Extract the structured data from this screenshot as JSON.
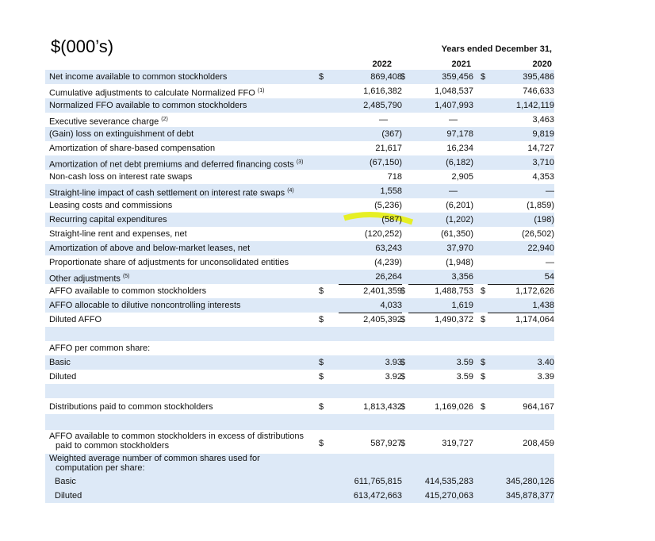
{
  "units_label": "$(000’s)",
  "header": {
    "period_title": "Years ended December 31,",
    "years": [
      "2022",
      "2021",
      "2020"
    ]
  },
  "rows": [
    {
      "label": "Net income available to common stockholders",
      "sup": "",
      "v": [
        "869,408",
        "359,456",
        "395,486"
      ]
    },
    {
      "label": "Cumulative adjustments to calculate Normalized FFO",
      "sup": "(1)",
      "v": [
        "1,616,382",
        "1,048,537",
        "746,633"
      ]
    },
    {
      "label": "Normalized FFO available to common stockholders",
      "sup": "",
      "v": [
        "2,485,790",
        "1,407,993",
        "1,142,119"
      ]
    },
    {
      "label": "Executive severance charge",
      "sup": "(2)",
      "v": [
        "—",
        "—",
        "3,463"
      ]
    },
    {
      "label": "(Gain) loss on extinguishment of debt",
      "sup": "",
      "v": [
        "(367)",
        "97,178",
        "9,819"
      ]
    },
    {
      "label": "Amortization of share-based compensation",
      "sup": "",
      "v": [
        "21,617",
        "16,234",
        "14,727"
      ]
    },
    {
      "label": "Amortization of net debt premiums and deferred financing costs",
      "sup": "(3)",
      "v": [
        "(67,150)",
        "(6,182)",
        "3,710"
      ]
    },
    {
      "label": "Non-cash loss on interest rate swaps",
      "sup": "",
      "v": [
        "718",
        "2,905",
        "4,353"
      ]
    },
    {
      "label": "Straight-line impact of cash settlement on interest rate swaps",
      "sup": "(4)",
      "v": [
        "1,558",
        "—",
        "—"
      ]
    },
    {
      "label": "Leasing costs and commissions",
      "sup": "",
      "v": [
        "(5,236)",
        "(6,201)",
        "(1,859)"
      ]
    },
    {
      "label": "Recurring capital expenditures",
      "sup": "",
      "v": [
        "(587)",
        "(1,202)",
        "(198)"
      ]
    },
    {
      "label": "Straight-line rent and expenses, net",
      "sup": "",
      "v": [
        "(120,252)",
        "(61,350)",
        "(26,502)"
      ]
    },
    {
      "label": "Amortization of above and below-market leases, net",
      "sup": "",
      "v": [
        "63,243",
        "37,970",
        "22,940"
      ]
    },
    {
      "label": "Proportionate share of adjustments for unconsolidated entities",
      "sup": "",
      "v": [
        "(4,239)",
        "(1,948)",
        "—"
      ]
    },
    {
      "label": "Other adjustments",
      "sup": "(5)",
      "v": [
        "26,264",
        "3,356",
        "54"
      ]
    },
    {
      "label": "AFFO available to common stockholders",
      "sup": "",
      "v": [
        "2,401,359",
        "1,488,753",
        "1,172,626"
      ]
    },
    {
      "label": "AFFO allocable to dilutive noncontrolling interests",
      "sup": "",
      "v": [
        "4,033",
        "1,619",
        "1,438"
      ]
    },
    {
      "label": "Diluted AFFO",
      "sup": "",
      "v": [
        "2,405,392",
        "1,490,372",
        "1,174,064"
      ]
    }
  ],
  "per_share": {
    "title": "AFFO per common share:",
    "basic_label": "Basic",
    "basic": [
      "3.93",
      "3.59",
      "3.40"
    ],
    "diluted_label": "Diluted",
    "diluted": [
      "3.92",
      "3.59",
      "3.39"
    ]
  },
  "distributions": {
    "label": "Distributions paid to common stockholders",
    "v": [
      "1,813,432",
      "1,169,026",
      "964,167"
    ]
  },
  "excess": {
    "label_1": "AFFO available to common stockholders in excess of distributions",
    "label_2": "paid to common stockholders",
    "v": [
      "587,927",
      "319,727",
      "208,459"
    ]
  },
  "weighted": {
    "label_1": "Weighted average number of common shares used for",
    "label_2": "computation per share:",
    "basic_label": "Basic",
    "basic": [
      "611,765,815",
      "414,535,283",
      "345,280,126"
    ],
    "diluted_label": "Diluted",
    "diluted": [
      "613,472,663",
      "415,270,063",
      "345,878,377"
    ]
  },
  "currency": "$",
  "highlight_color": "#e8f000"
}
